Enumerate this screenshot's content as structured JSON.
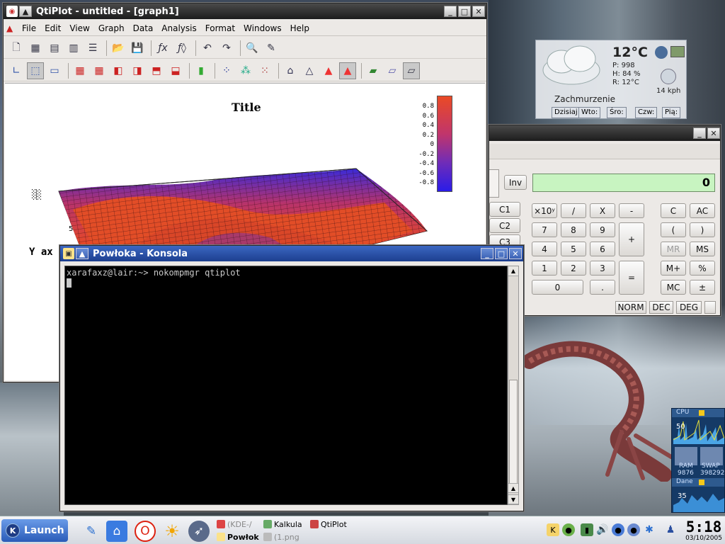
{
  "qtiplot": {
    "title": "QtiPlot - untitled - [graph1]",
    "menu": [
      "File",
      "Edit",
      "View",
      "Graph",
      "Data",
      "Analysis",
      "Format",
      "Windows",
      "Help"
    ],
    "toolbar1": [
      "new-project",
      "new-table",
      "new-matrix",
      "new-note",
      "new-graph",
      "open",
      "save",
      "add-function",
      "add-3d-function",
      "undo",
      "redo",
      "preview",
      "edit"
    ],
    "toolbar2": [
      "axes-none",
      "frame-box",
      "frame-none",
      "grid-front",
      "grid-back",
      "grid-left",
      "grid-right",
      "grid-ceiling",
      "grid-floor",
      "bars",
      "points",
      "cones",
      "crosses",
      "wireframe",
      "hidden-line",
      "polygon-fill",
      "filled-mesh",
      "floor-data",
      "floor-iso",
      "floor-empty"
    ],
    "graph": {
      "title": "Title",
      "yaxis_label": "Y ax",
      "tick_5": "5",
      "colorbar_ticks": [
        "0.8",
        "0.6",
        "0.4",
        "0.2",
        "0",
        "-0.2",
        "-0.4",
        "-0.6",
        "-0.8"
      ]
    }
  },
  "konsole": {
    "title": "Powłoka - Konsola",
    "line1": "xarafaxz@lair:~> nokompmgr qtiplot"
  },
  "calc": {
    "display": "0",
    "inv": "Inv",
    "memory": [
      "C1",
      "C2",
      "C3"
    ],
    "keys": {
      "exp": "×10ʸ",
      "div": "/",
      "mul": "X",
      "minus": "-",
      "plus": "+",
      "eq": "=",
      "d7": "7",
      "d8": "8",
      "d9": "9",
      "d4": "4",
      "d5": "5",
      "d6": "6",
      "d1": "1",
      "d2": "2",
      "d3": "3",
      "d0": "0",
      "dot": ".",
      "c": "C",
      "ac": "AC",
      "lpar": "(",
      "rpar": ")",
      "mr": "MR",
      "ms": "MS",
      "mplus": "M+",
      "pct": "%",
      "mc": "MC",
      "pm": "±"
    },
    "modes": [
      "NORM",
      "DEC",
      "DEG"
    ]
  },
  "weather": {
    "temp": "12°C",
    "p": "P: 998",
    "h": "H: 84 %",
    "r": "R: 12°C",
    "wind": "14 kph",
    "condition": "Zachmurzenie",
    "days": [
      "Dzisiaj",
      "Wto:",
      "Śro:",
      "Czw:",
      "Pią:"
    ]
  },
  "sysmon": {
    "cpu": "CPU",
    "cpu_val": "50",
    "ram": "RAM",
    "ram_val": "9876",
    "swap": "SWAP",
    "swap_val": "398292",
    "net": "Dane",
    "net_val": "35"
  },
  "taskbar": {
    "launch": "Launch",
    "tasks": [
      "(KDE-/",
      "Kalkula",
      "QtiPlot",
      "Powłok",
      "(1.png"
    ],
    "time": "5:18",
    "date": "03/10/2005"
  },
  "colors": {
    "accent": "#2a5bb8",
    "calc_display": "#c8f4c1",
    "colormap_top": "#e8432a",
    "colormap_bottom": "#2a20e8"
  }
}
